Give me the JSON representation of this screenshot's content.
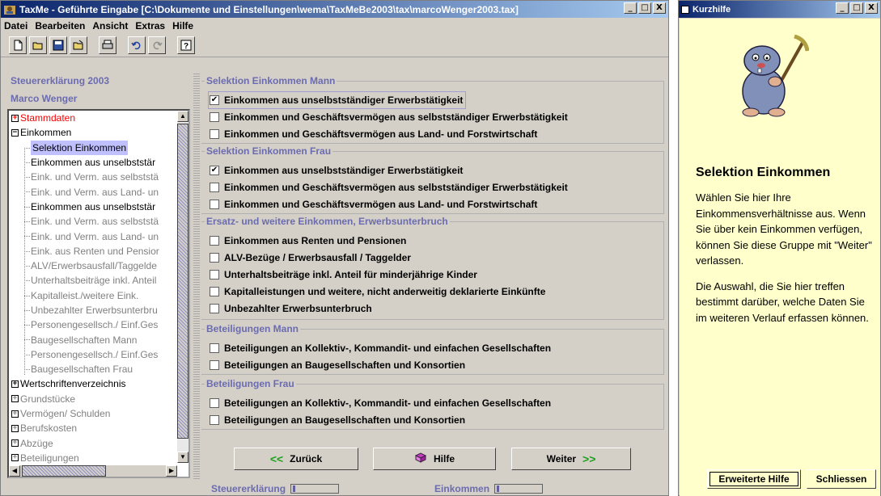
{
  "main_window": {
    "title": "TaxMe - Geführte Eingabe  [C:\\Dokumente und Einstellungen\\wema\\TaxMeBe2003\\tax\\marcoWenger2003.tax]",
    "controls": {
      "minimize": "_",
      "maximize": "□",
      "close": "X"
    }
  },
  "menu": [
    "Datei",
    "Bearbeiten",
    "Ansicht",
    "Extras",
    "Hilfe"
  ],
  "toolbar_icons": [
    "new-file-icon",
    "open-folder-icon",
    "save-icon",
    "close-file-icon",
    "print-icon",
    "undo-icon",
    "redo-icon",
    "help-icon"
  ],
  "left_panel": {
    "title": "Steuererklärung 2003",
    "subtitle": "Marco Wenger",
    "tree": [
      {
        "label": "Stammdaten",
        "expander": "+",
        "color": "#ff0000"
      },
      {
        "label": "Einkommen",
        "expander": "−",
        "color": "#000000"
      },
      {
        "label": "Selektion Einkommen",
        "child": true,
        "selected": true,
        "color": "#000000"
      },
      {
        "label": "Einkommen aus unselbststär",
        "child": true,
        "color": "#000000"
      },
      {
        "label": "Eink. und Verm. aus selbststä",
        "child": true,
        "color": "#808080"
      },
      {
        "label": "Eink. und Verm. aus Land- un",
        "child": true,
        "color": "#808080"
      },
      {
        "label": "Einkommen aus unselbststär",
        "child": true,
        "color": "#000000"
      },
      {
        "label": "Eink. und Verm. aus selbststä",
        "child": true,
        "color": "#808080"
      },
      {
        "label": "Eink. und Verm. aus Land- un",
        "child": true,
        "color": "#808080"
      },
      {
        "label": "Eink. aus Renten und Pensior",
        "child": true,
        "color": "#808080"
      },
      {
        "label": "ALV/Erwerbsausfall/Taggelde",
        "child": true,
        "color": "#808080"
      },
      {
        "label": "Unterhaltsbeiträge inkl. Anteil",
        "child": true,
        "color": "#808080"
      },
      {
        "label": "Kapitalleist./weitere Eink.",
        "child": true,
        "color": "#808080"
      },
      {
        "label": "Unbezahlter Erwerbsunterbru",
        "child": true,
        "color": "#808080"
      },
      {
        "label": "Personengesellsch./ Einf.Ges",
        "child": true,
        "color": "#808080"
      },
      {
        "label": "Baugesellschaften Mann",
        "child": true,
        "color": "#808080"
      },
      {
        "label": "Personengesellsch./ Einf.Ges",
        "child": true,
        "color": "#808080"
      },
      {
        "label": "Baugesellschaften Frau",
        "child": true,
        "color": "#808080"
      },
      {
        "label": "Wertschriftenverzeichnis",
        "expander": "+",
        "color": "#000000"
      },
      {
        "label": "Grundstücke",
        "expander": "+",
        "color": "#808080"
      },
      {
        "label": "Vermögen/ Schulden",
        "expander": "+",
        "color": "#808080"
      },
      {
        "label": "Berufskosten",
        "expander": "+",
        "color": "#808080"
      },
      {
        "label": "Abzüge",
        "expander": "+",
        "color": "#808080"
      },
      {
        "label": "Beteiligungen",
        "expander": "+",
        "color": "#808080"
      }
    ]
  },
  "groups": {
    "mann": {
      "title": "Selektion Einkommen Mann",
      "items": [
        {
          "label": "Einkommen aus unselbstständiger Erwerbstätigkeit",
          "checked": true
        },
        {
          "label": "Einkommen und Geschäftsvermögen aus selbstständiger Erwerbstätigkeit",
          "checked": false
        },
        {
          "label": "Einkommen und Geschäftsvermögen aus Land- und Forstwirtschaft",
          "checked": false
        }
      ]
    },
    "frau": {
      "title": "Selektion Einkommen Frau",
      "items": [
        {
          "label": "Einkommen aus unselbstständiger Erwerbstätigkeit",
          "checked": true
        },
        {
          "label": "Einkommen und Geschäftsvermögen aus selbstständiger Erwerbstätigkeit",
          "checked": false
        },
        {
          "label": "Einkommen und Geschäftsvermögen aus Land- und Forstwirtschaft",
          "checked": false
        }
      ]
    },
    "ersatz": {
      "title": "Ersatz- und weitere Einkommen, Erwerbsunterbruch",
      "items": [
        {
          "label": "Einkommen aus Renten und Pensionen",
          "checked": false
        },
        {
          "label": "ALV-Bezüge / Erwerbsausfall / Taggelder",
          "checked": false
        },
        {
          "label": "Unterhaltsbeiträge inkl. Anteil für minderjährige Kinder",
          "checked": false
        },
        {
          "label": "Kapitalleistungen und weitere, nicht anderweitig deklarierte Einkünfte",
          "checked": false
        },
        {
          "label": "Unbezahlter Erwerbsunterbruch",
          "checked": false
        }
      ]
    },
    "bet_mann": {
      "title": "Beteiligungen Mann",
      "items": [
        {
          "label": "Beteiligungen an Kollektiv-, Kommandit- und einfachen Gesellschaften",
          "checked": false
        },
        {
          "label": "Beteiligungen an Baugesellschaften und Konsortien",
          "checked": false
        }
      ]
    },
    "bet_frau": {
      "title": "Beteiligungen Frau",
      "items": [
        {
          "label": "Beteiligungen an Kollektiv-, Kommandit- und einfachen Gesellschaften",
          "checked": false
        },
        {
          "label": "Beteiligungen an Baugesellschaften und Konsortien",
          "checked": false
        }
      ]
    }
  },
  "nav": {
    "back_label": "Zurück",
    "back_arrows": "<<",
    "help_label": "Hilfe",
    "next_label": "Weiter",
    "next_arrows": ">>"
  },
  "status": {
    "left_label": "Steuererklärung",
    "right_label": "Einkommen"
  },
  "help_window": {
    "title": "Kurzhilfe",
    "heading": "Selektion Einkommen",
    "paragraph1": "Wählen Sie hier Ihre Einkommensverhältnisse aus. Wenn Sie über kein Einkommen verfügen, können Sie diese Gruppe mit \"Weiter\" verlassen.",
    "paragraph2": "Die Auswahl, die Sie hier treffen bestimmt darüber, welche Daten Sie im weiteren Verlauf erfassen können.",
    "extended_help_label": "Erweiterte Hilfe",
    "close_label": "Schliessen"
  },
  "colors": {
    "accent": "#6b6bb0",
    "next_arrow": "#1da11d",
    "help_bg": "#ffffcc",
    "selection": "#c0c0ff"
  }
}
